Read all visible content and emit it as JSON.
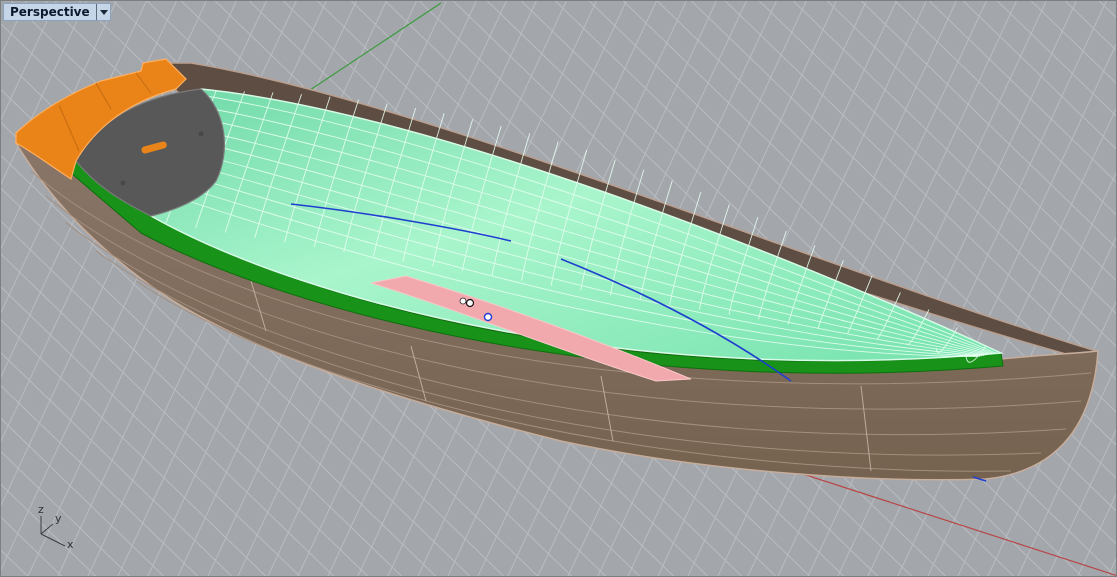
{
  "viewport": {
    "title": "Perspective",
    "menu_icon": "chevron-down-icon"
  },
  "axes": {
    "x_label": "x",
    "y_label": "y",
    "z_label": "z"
  },
  "colors": {
    "background": "#a3a7ac",
    "grid": "#b7bbbf",
    "x_axis": "#b84646",
    "y_axis": "#3c9a3c",
    "hull_exterior": "#7f6c5e",
    "hull_interior": "#5e4d42",
    "selected_surface": "#8ff2bf",
    "selected_outline": "#189218",
    "transom": "#585858",
    "knee": "#ea8419",
    "keel_highlight": "#f2a9ad",
    "curve": "#1f3fd0"
  }
}
